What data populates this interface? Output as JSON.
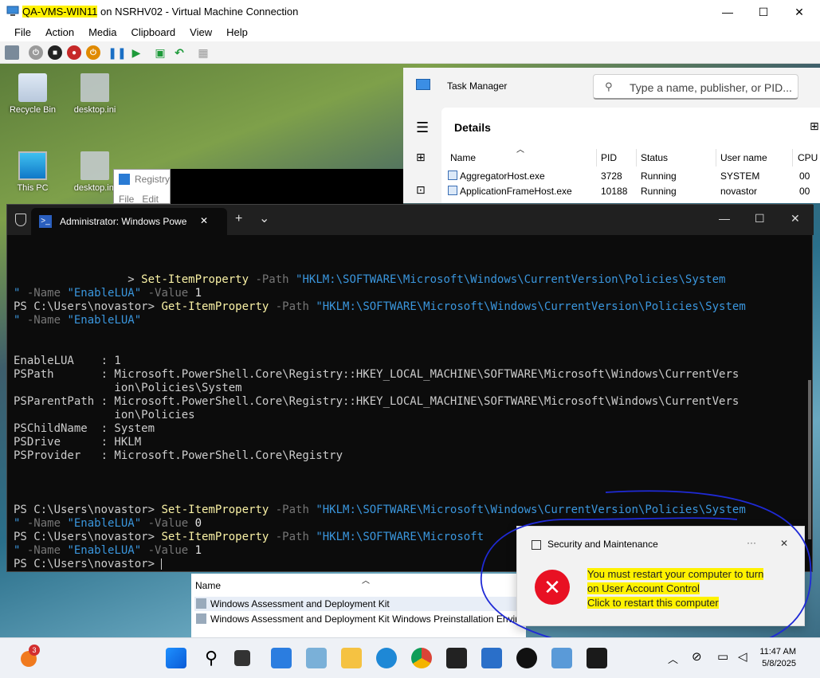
{
  "window": {
    "vm_name": "QA-VMS-WIN11",
    "title_rest": " on NSRHV02 - Virtual Machine Connection",
    "minimize": "—",
    "maximize": "☐",
    "close": "✕"
  },
  "menu": [
    "File",
    "Action",
    "Media",
    "Clipboard",
    "View",
    "Help"
  ],
  "desktop_icons": [
    {
      "label": "Recycle Bin",
      "icon": "recycle-bin-icon"
    },
    {
      "label": "desktop.ini",
      "icon": "file-icon"
    },
    {
      "label": "This PC",
      "icon": "monitor-icon"
    },
    {
      "label": "desktop.ini",
      "icon": "file-icon"
    }
  ],
  "registry_window": {
    "title": "Registry",
    "menu": "File   Edit"
  },
  "task_manager": {
    "title": "Task Manager",
    "search_placeholder": "Type a name, publisher, or PID...",
    "section": "Details",
    "columns": [
      "Name",
      "PID",
      "Status",
      "User name",
      "CPU"
    ],
    "rows": [
      [
        "AggregatorHost.exe",
        "3728",
        "Running",
        "SYSTEM",
        "00"
      ],
      [
        "ApplicationFrameHost.exe",
        "10188",
        "Running",
        "novastor",
        "00"
      ]
    ]
  },
  "terminal": {
    "tab_title": "Administrator: Windows Powe",
    "tab_close": "✕",
    "new_tab": "+",
    "dropdown": "⌄"
  },
  "console": {
    "l1_prompt": "                 > ",
    "l1_cmd": "Set-ItemProperty",
    "l1_p1": " -Path ",
    "l1_path": "\"HKLM:\\SOFTWARE\\Microsoft\\Windows\\CurrentVersion\\Policies\\System",
    "l2_pathend": "\"",
    "l2_p2": " -Name ",
    "l2_name": "\"EnableLUA\"",
    "l2_p3": " -Value ",
    "l2_val": "1",
    "l3_prompt": "PS C:\\Users\\novastor> ",
    "l3_cmd": "Get-ItemProperty",
    "l3_p1": " -Path ",
    "l3_path": "\"HKLM:\\SOFTWARE\\Microsoft\\Windows\\CurrentVersion\\Policies\\System",
    "l4_pathend": "\"",
    "l4_p2": " -Name ",
    "l4_name": "\"EnableLUA\"",
    "out1": "EnableLUA    : 1",
    "out2": "PSPath       : Microsoft.PowerShell.Core\\Registry::HKEY_LOCAL_MACHINE\\SOFTWARE\\Microsoft\\Windows\\CurrentVers",
    "out3": "               ion\\Policies\\System",
    "out4": "PSParentPath : Microsoft.PowerShell.Core\\Registry::HKEY_LOCAL_MACHINE\\SOFTWARE\\Microsoft\\Windows\\CurrentVers",
    "out5": "               ion\\Policies",
    "out6": "PSChildName  : System",
    "out7": "PSDrive      : HKLM",
    "out8": "PSProvider   : Microsoft.PowerShell.Core\\Registry",
    "l5_prompt": "PS C:\\Users\\novastor> ",
    "l5_cmd": "Set-ItemProperty",
    "l5_p1": " -Path ",
    "l5_path": "\"HKLM:\\SOFTWARE\\Microsoft\\Windows\\CurrentVersion\\Policies\\System",
    "l6_pathend": "\"",
    "l6_p2": " -Name ",
    "l6_name": "\"EnableLUA\"",
    "l6_p3": " -Value ",
    "l6_val": "0",
    "l7_prompt": "PS C:\\Users\\novastor> ",
    "l7_cmd": "Set-ItemProperty",
    "l7_p1": " -Path ",
    "l7_path": "\"HKLM:\\SOFTWARE\\Microsoft",
    "l8_pathend": "\"",
    "l8_p2": " -Name ",
    "l8_name": "\"EnableLUA\"",
    "l8_p3": " -Value ",
    "l8_val": "1",
    "l9_prompt": "PS C:\\Users\\novastor> "
  },
  "installer": {
    "column": "Name",
    "rows": [
      "Windows Assessment and Deployment Kit",
      "Windows Assessment and Deployment Kit Windows Preinstallation Envir"
    ]
  },
  "toast": {
    "app": "Security and Maintenance",
    "more": "···",
    "close": "✕",
    "line1": "You must restart your computer to turn",
    "line2": "on User Account Control",
    "line3": "Click to restart this computer"
  },
  "taskbar": {
    "badge": "3",
    "time": "11:47 AM",
    "date": "5/8/2025"
  },
  "colors": {
    "highlight": "#fff200",
    "annotation": "#1f2ad6",
    "toast_error": "#e81123"
  }
}
